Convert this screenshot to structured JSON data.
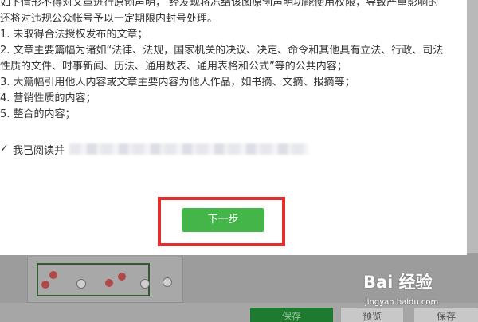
{
  "notice": {
    "lines": [
      "如下情形不得对文章进行原创声明，  经发现将冻结该图原创声明功能使用权限，导致严重影响的",
      "还将对违规公众帐号予以一定期限内封号处理。",
      "1. 未取得合法授权发布的文章；",
      "2. 文章主要篇幅为诸如“法律、法规，国家机关的决议、决定、命令和其他具有立法、行政、司法",
      "性质的文件、时事新闻、历法、通用数表、通用表格和公式”等的公共内容；",
      "3. 大篇幅引用他人内容或文章主要内容为他人作品，如书摘、文摘、报摘等；",
      "4. 营销性质的内容；",
      "5. 整合的内容；"
    ]
  },
  "agree": {
    "label": "我已阅读并"
  },
  "actions": {
    "next_label": "下一步"
  },
  "background": {
    "save_label": "保存",
    "preview_label": "预览",
    "publish_label": "保存"
  },
  "watermark": {
    "logo": "Bai 经验",
    "url": "jingyan.baidu.com"
  },
  "colors": {
    "primary_green": "#44b549",
    "highlight_red": "#e52d2d"
  }
}
